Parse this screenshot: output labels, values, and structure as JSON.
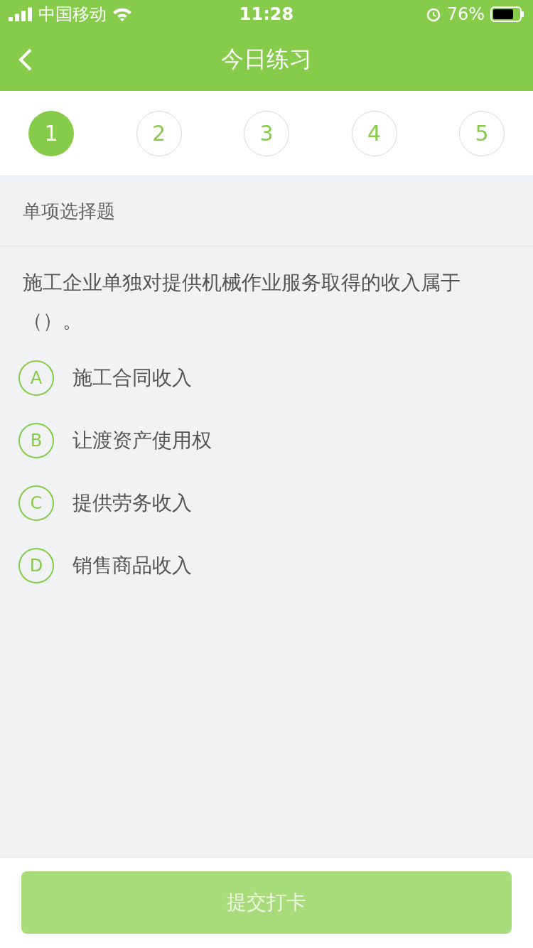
{
  "status_bar": {
    "carrier": "中国移动",
    "time": "11:28",
    "battery": "76%"
  },
  "nav": {
    "title": "今日练习"
  },
  "steps": [
    {
      "label": "1",
      "selected": true
    },
    {
      "label": "2",
      "selected": false
    },
    {
      "label": "3",
      "selected": false
    },
    {
      "label": "4",
      "selected": false
    },
    {
      "label": "5",
      "selected": false
    }
  ],
  "section": {
    "title": "单项选择题"
  },
  "question": "施工企业单独对提供机械作业服务取得的收入属于（）。",
  "options": [
    {
      "letter": "A",
      "text": "施工合同收入",
      "selected": false
    },
    {
      "letter": "B",
      "text": "让渡资产使用权",
      "selected": false
    },
    {
      "letter": "C",
      "text": "提供劳务收入",
      "selected": false
    },
    {
      "letter": "D",
      "text": "销售商品收入",
      "selected": false
    }
  ],
  "submit": {
    "label": "提交打卡",
    "disabled": true
  }
}
